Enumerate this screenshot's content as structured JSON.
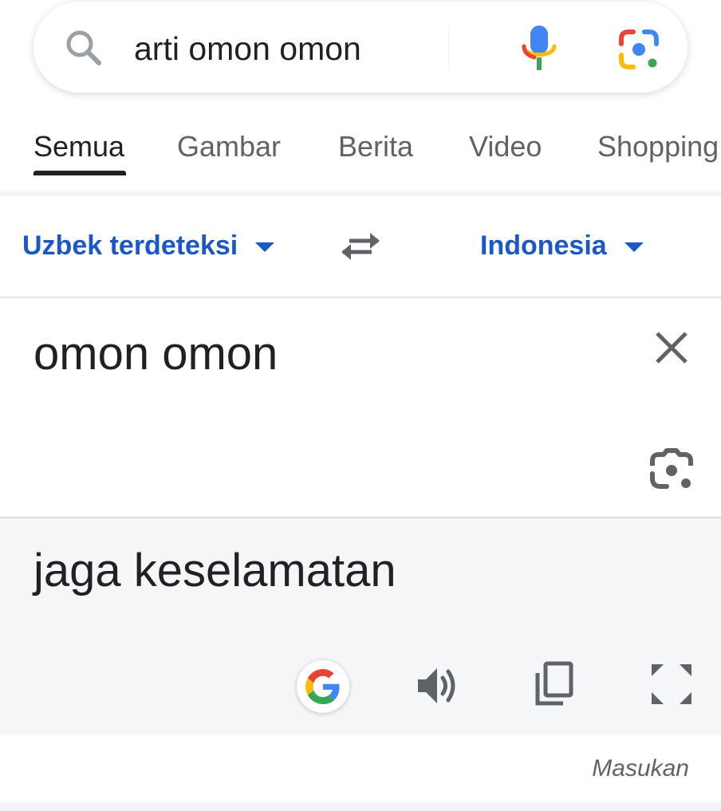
{
  "search": {
    "query": "arti omon omon",
    "icons": {
      "search": "search-icon",
      "voice": "mic-icon",
      "lens": "google-lens-icon"
    }
  },
  "tabs": [
    {
      "label": "Semua",
      "active": true
    },
    {
      "label": "Gambar",
      "active": false
    },
    {
      "label": "Berita",
      "active": false
    },
    {
      "label": "Video",
      "active": false
    },
    {
      "label": "Shopping",
      "active": false
    }
  ],
  "translator": {
    "source_language": "Uzbek terdeteksi",
    "target_language": "Indonesia",
    "source_text": "omon omon",
    "translated_text": "jaga keselamatan",
    "icons": {
      "swap": "swap-languages-icon",
      "clear": "close-icon",
      "camera": "camera-translate-icon",
      "google": "google-g-icon",
      "listen": "speaker-icon",
      "copy": "copy-icon",
      "fullscreen": "expand-icon"
    },
    "feedback_label": "Masukan"
  },
  "colors": {
    "link_blue": "#1a57c8",
    "text_primary": "#202124",
    "text_secondary": "#5f6368",
    "result_background": "#f5f6f8"
  }
}
